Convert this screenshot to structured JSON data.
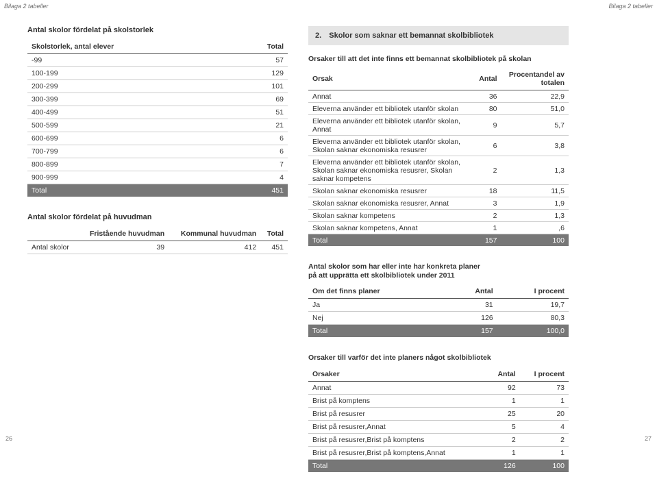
{
  "header": {
    "left": "Bilaga 2 tabeller",
    "right": "Bilaga 2 tabeller"
  },
  "footer": {
    "left": "26",
    "right": "27"
  },
  "left": {
    "t1": {
      "title": "Antal skolor fördelat på skolstorlek",
      "h1": "Skolstorlek, antal elever",
      "h2": "Total",
      "rows": [
        {
          "a": "-99",
          "b": "57"
        },
        {
          "a": "100-199",
          "b": "129"
        },
        {
          "a": "200-299",
          "b": "101"
        },
        {
          "a": "300-399",
          "b": "69"
        },
        {
          "a": "400-499",
          "b": "51"
        },
        {
          "a": "500-599",
          "b": "21"
        },
        {
          "a": "600-699",
          "b": "6"
        },
        {
          "a": "700-799",
          "b": "6"
        },
        {
          "a": "800-899",
          "b": "7"
        },
        {
          "a": "900-999",
          "b": "4"
        }
      ],
      "total": {
        "a": "Total",
        "b": "451"
      }
    },
    "t2": {
      "title": "Antal skolor fördelat på huvudman",
      "h1": "",
      "h2": "Fristående huvudman",
      "h3": "Kommunal huvudman",
      "h4": "Total",
      "row": {
        "a": "Antal skolor",
        "b": "39",
        "c": "412",
        "d": "451"
      }
    }
  },
  "right": {
    "banner": {
      "num": "2.",
      "text": "Skolor som saknar ett bemannat skolbibliotek"
    },
    "t3": {
      "title": "Orsaker till att det inte finns ett bemannat skolbibliotek på skolan",
      "h1": "Orsak",
      "h2": "Antal",
      "h3": "Procentandel av totalen",
      "rows": [
        {
          "a": "Annat",
          "b": "36",
          "c": "22,9"
        },
        {
          "a": "Eleverna använder ett bibliotek utanför skolan",
          "b": "80",
          "c": "51,0"
        },
        {
          "a": "Eleverna använder ett bibliotek utanför skolan, Annat",
          "b": "9",
          "c": "5,7"
        },
        {
          "a": "Eleverna använder ett bibliotek utanför skolan, Skolan saknar ekonomiska resusrer",
          "b": "6",
          "c": "3,8"
        },
        {
          "a": "Eleverna använder ett bibliotek utanför skolan, Skolan saknar ekonomiska resusrer, Skolan saknar kompetens",
          "b": "2",
          "c": "1,3"
        },
        {
          "a": "Skolan saknar ekonomiska resusrer",
          "b": "18",
          "c": "11,5"
        },
        {
          "a": "Skolan saknar ekonomiska resusrer, Annat",
          "b": "3",
          "c": "1,9"
        },
        {
          "a": "Skolan saknar kompetens",
          "b": "2",
          "c": "1,3"
        },
        {
          "a": "Skolan saknar kompetens, Annat",
          "b": "1",
          "c": ",6"
        }
      ],
      "total": {
        "a": "Total",
        "b": "157",
        "c": "100"
      }
    },
    "t4": {
      "title": "Antal skolor som har eller inte har konkreta planer på att upprätta ett skolbibliotek under 2011",
      "h1": "Om det finns planer",
      "h2": "Antal",
      "h3": "I procent",
      "rows": [
        {
          "a": "Ja",
          "b": "31",
          "c": "19,7"
        },
        {
          "a": "Nej",
          "b": "126",
          "c": "80,3"
        }
      ],
      "total": {
        "a": "Total",
        "b": "157",
        "c": "100,0"
      }
    },
    "t5": {
      "title": "Orsaker till varför det inte planers något skolbibliotek",
      "h1": "Orsaker",
      "h2": "Antal",
      "h3": "I procent",
      "rows": [
        {
          "a": "Annat",
          "b": "92",
          "c": "73"
        },
        {
          "a": "Brist på komptens",
          "b": "1",
          "c": "1"
        },
        {
          "a": "Brist på resusrer",
          "b": "25",
          "c": "20"
        },
        {
          "a": "Brist på resusrer,Annat",
          "b": "5",
          "c": "4"
        },
        {
          "a": "Brist på resusrer,Brist på komptens",
          "b": "2",
          "c": "2"
        },
        {
          "a": "Brist på resusrer,Brist på komptens,Annat",
          "b": "1",
          "c": "1"
        }
      ],
      "total": {
        "a": "Total",
        "b": "126",
        "c": "100"
      }
    }
  }
}
